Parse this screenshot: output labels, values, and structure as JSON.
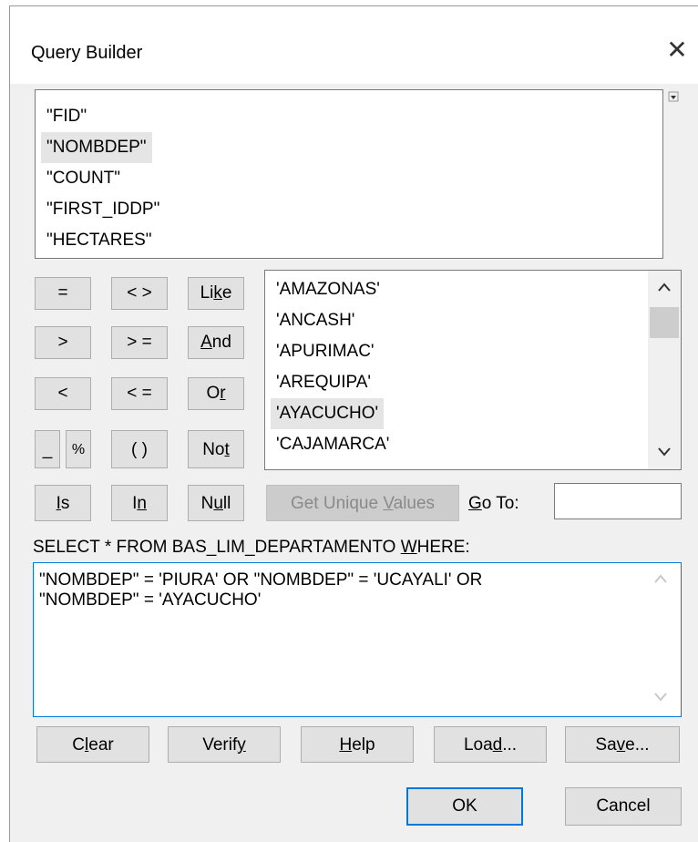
{
  "dialog": {
    "title": "Query Builder",
    "close_glyph": "✕"
  },
  "fields": [
    "\"FID\"",
    "\"NOMBDEP\"",
    "\"COUNT\"",
    "\"FIRST_IDDP\"",
    "\"HECTARES\""
  ],
  "operators": {
    "eq": "=",
    "ne": "< >",
    "like": [
      "Li",
      "k",
      "e"
    ],
    "gt": ">",
    "ge": "> =",
    "and": [
      "",
      "A",
      "nd"
    ],
    "lt": "<",
    "le": "< =",
    "or": [
      "O",
      "r",
      ""
    ],
    "underscore": "_",
    "percent": "%",
    "parens": "( )",
    "not": [
      "No",
      "t",
      ""
    ],
    "is": [
      "",
      "I",
      "s"
    ],
    "in": [
      "I",
      "n",
      ""
    ],
    "null": [
      "N",
      "u",
      "ll"
    ]
  },
  "values": [
    "'AMAZONAS'",
    "'ANCASH'",
    "'APURIMAC'",
    "'AREQUIPA'",
    "'AYACUCHO'",
    "'CAJAMARCA'"
  ],
  "get_unique": [
    "Get Unique ",
    "V",
    "alues"
  ],
  "goto": {
    "label": [
      "",
      "G",
      "o To:"
    ],
    "value": ""
  },
  "where_label": [
    "SELECT * FROM BAS_LIM_DEPARTAMENTO ",
    "W",
    "HERE:"
  ],
  "expression": "\"NOMBDEP\" = 'PIURA' OR \"NOMBDEP\" = 'UCAYALI' OR\n\"NOMBDEP\" = 'AYACUCHO'",
  "bottom_buttons": {
    "clear": [
      "C",
      "l",
      "ear"
    ],
    "verify": [
      "Verif",
      "y",
      ""
    ],
    "help": [
      "",
      "H",
      "elp"
    ],
    "load": [
      "Loa",
      "d",
      "..."
    ],
    "save": [
      "Sa",
      "v",
      "e..."
    ]
  },
  "ok": "OK",
  "cancel": "Cancel",
  "colors": {
    "accent": "#0078d7",
    "button": "#e1e1e1",
    "dialog_bg": "#f0f0f0",
    "highlight": "#e5e5e5"
  }
}
